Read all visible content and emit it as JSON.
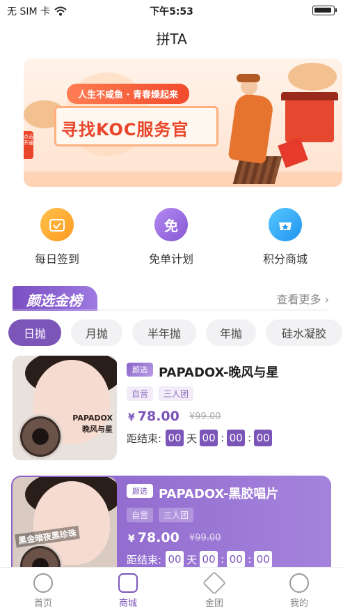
{
  "status_bar": {
    "carrier": "无 SIM 卡",
    "time": "下午5:53",
    "wifi_icon": "wifi-icon",
    "battery_icon": "battery-icon"
  },
  "nav": {
    "title": "拼TA"
  },
  "banner": {
    "tagline": "人生不咸鱼 · 青春燥起来",
    "headline": "寻找KOC服务官",
    "side_tab": "点击开通"
  },
  "quick_actions": [
    {
      "label": "每日签到",
      "icon": "calendar-check-icon",
      "color": "#ffa62b"
    },
    {
      "label": "免单计划",
      "icon": "free-icon",
      "glyph": "免",
      "color": "#9b6ee0"
    },
    {
      "label": "积分商城",
      "icon": "shopping-basket-icon",
      "color": "#2fa8f5"
    }
  ],
  "section": {
    "title": "颜选金榜",
    "see_more": "查看更多 ›"
  },
  "tabs": [
    "日抛",
    "月抛",
    "半年抛",
    "年抛",
    "硅水凝胶"
  ],
  "products": [
    {
      "badge": "颜选",
      "name": "PAPADOX-晚风与星",
      "tags": [
        "自营",
        "三人团"
      ],
      "price": "78.00",
      "currency": "¥",
      "original_price": "¥99.00",
      "countdown_label": "距结束:",
      "countdown": {
        "days": "00",
        "day_unit": "天",
        "hours": "00",
        "minutes": "00",
        "seconds": "00"
      },
      "thumb_brand": "PAPADOX",
      "thumb_subtitle": "晚风与星"
    },
    {
      "badge": "颜选",
      "name": "PAPADOX-黑胶唱片",
      "tags": [
        "自营",
        "三人团"
      ],
      "price": "78.00",
      "currency": "¥",
      "original_price": "¥99.00",
      "countdown_label": "距结束:",
      "countdown": {
        "days": "00",
        "day_unit": "天",
        "hours": "00",
        "minutes": "00",
        "seconds": "00"
      },
      "thumb_banner": "黑金暗夜黑珍珠"
    }
  ],
  "tabbar": [
    {
      "label": "首页",
      "icon": "planet-icon"
    },
    {
      "label": "商城",
      "icon": "shop-bag-icon",
      "active": true
    },
    {
      "label": "金团",
      "icon": "cube-icon"
    },
    {
      "label": "我的",
      "icon": "smiley-icon"
    }
  ],
  "colors": {
    "accent": "#7b55b8",
    "banner_red": "#e9452a"
  }
}
